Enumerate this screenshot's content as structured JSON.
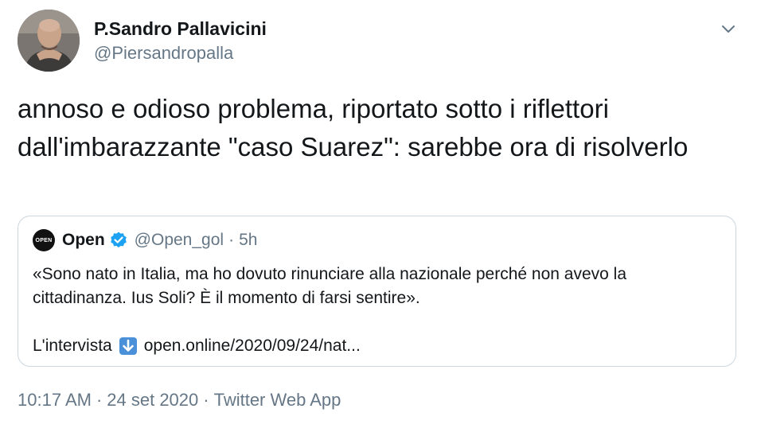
{
  "author": {
    "display_name": "P.Sandro Pallavicini",
    "handle": "@Piersandropalla"
  },
  "menu_icon": "chevron-down-icon",
  "tweet": {
    "text": "annoso e odioso problema, riportato sotto i riflettori dall'imbarazzante \"caso Suarez\": sarebbe ora di risolverlo"
  },
  "quoted_tweet": {
    "avatar_text": "OPEN",
    "name": "Open",
    "verified_icon": "verified-badge-icon",
    "handle": "@Open_gol",
    "separator": "·",
    "time": "5h",
    "body": "«Sono nato in Italia, ma ho dovuto rinunciare alla nazionale perché non avevo la cittadinanza. Ius Soli? È il momento di farsi sentire».",
    "link_prefix": "L'intervista",
    "link_icon": "down-arrow-emoji-icon",
    "link_text": "open.online/2020/09/24/nat..."
  },
  "footer": {
    "time": "10:17 AM",
    "separator": "·",
    "date": "24 set 2020",
    "separator2": "·",
    "source": "Twitter Web App"
  },
  "colors": {
    "text_primary": "#14171a",
    "text_secondary": "#657786",
    "border": "#ccd6dd",
    "verified_blue": "#1da1f2",
    "emoji_blue": "#4a90d9"
  }
}
